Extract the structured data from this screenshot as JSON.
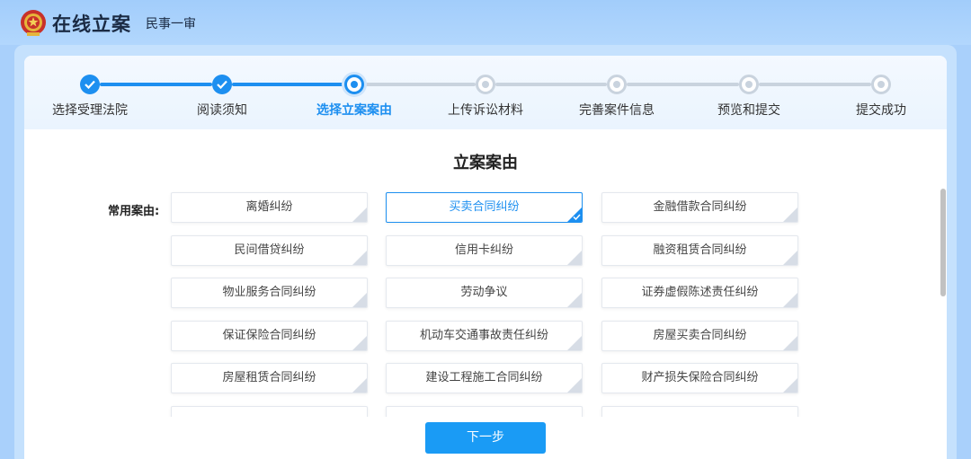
{
  "header": {
    "title": "在线立案",
    "subtitle": "民事一审",
    "logo_icon": "court-emblem-icon"
  },
  "steps": [
    {
      "label": "选择受理法院",
      "state": "done"
    },
    {
      "label": "阅读须知",
      "state": "done"
    },
    {
      "label": "选择立案案由",
      "state": "current"
    },
    {
      "label": "上传诉讼材料",
      "state": "todo"
    },
    {
      "label": "完善案件信息",
      "state": "todo"
    },
    {
      "label": "预览和提交",
      "state": "todo"
    },
    {
      "label": "提交成功",
      "state": "todo"
    }
  ],
  "section_title": "立案案由",
  "common_label": "常用案由:",
  "causes": [
    [
      "离婚纠纷",
      "买卖合同纠纷",
      "金融借款合同纠纷"
    ],
    [
      "民间借贷纠纷",
      "信用卡纠纷",
      "融资租赁合同纠纷"
    ],
    [
      "物业服务合同纠纷",
      "劳动争议",
      "证券虚假陈述责任纠纷"
    ],
    [
      "保证保险合同纠纷",
      "机动车交通事故责任纠纷",
      "房屋买卖合同纠纷"
    ],
    [
      "房屋租赁合同纠纷",
      "建设工程施工合同纠纷",
      "财产损失保险合同纠纷"
    ]
  ],
  "selected_cause": "买卖合同纠纷",
  "next_button": "下一步",
  "colors": {
    "accent": "#1d8ff0",
    "button": "#1a9bf5",
    "background": "#a9d0fb"
  }
}
